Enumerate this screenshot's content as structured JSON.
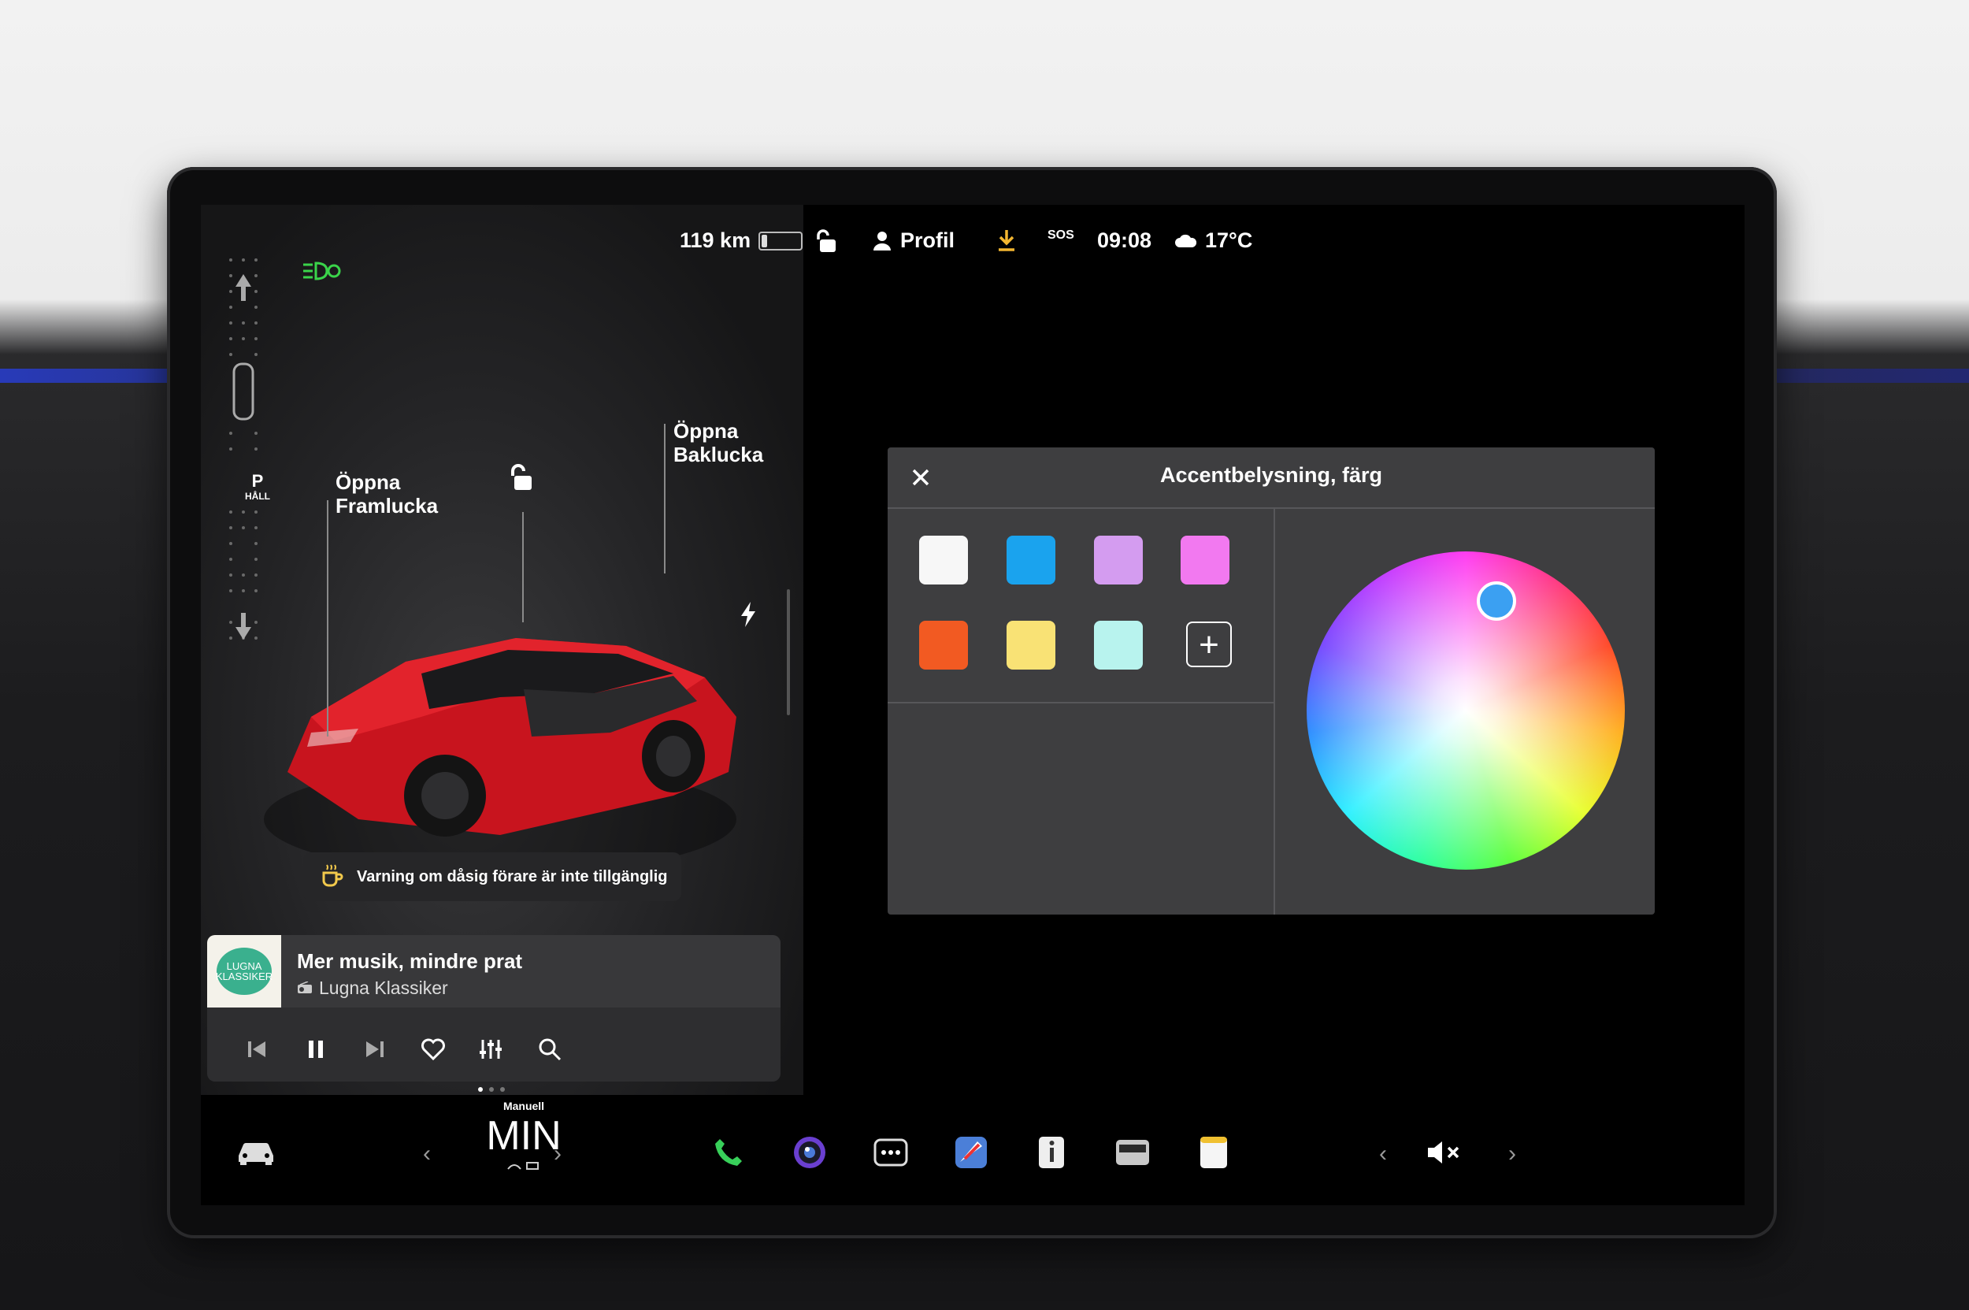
{
  "status_bar": {
    "range": "119 km",
    "battery_level_pct": 15,
    "profile_label": "Profil",
    "sos_label": "SOS",
    "time": "09:08",
    "temperature": "17°C",
    "icons": [
      "lock-open-icon",
      "person-icon",
      "download-icon",
      "sos-icon",
      "cloud-icon"
    ]
  },
  "car_panel": {
    "gear_selected": "P",
    "gear_hold": "HÅLL",
    "frunk_label": "Öppna\nFramlucka",
    "trunk_label": "Öppna\nBaklucka",
    "warning_text": "Varning om dåsig förare är inte tillgänglig",
    "icons": [
      "headlight-icon",
      "arrow-up-icon",
      "car-top-icon",
      "arrow-down-icon",
      "lock-open-icon",
      "charge-bolt-icon",
      "coffee-icon"
    ]
  },
  "music": {
    "title": "Mer musik, mindre prat",
    "source": "Lugna Klassiker",
    "cover_text": "LUGNA KLASSIKER",
    "controls": [
      "previous-icon",
      "pause-icon",
      "next-icon",
      "heart-icon",
      "equalizer-icon",
      "search-icon"
    ]
  },
  "dialog": {
    "title": "Accentbelysning, färg",
    "swatches": [
      "#f7f7f7",
      "#1aa3ee",
      "#d49cf0",
      "#f279f0",
      "#f25a22",
      "#f9e275",
      "#b8f3ee"
    ],
    "selected_color": "#3ba0f2",
    "add_label": "+"
  },
  "dock": {
    "climate_mode": "Manuell",
    "fan_value": "MIN",
    "apps": [
      "car-icon",
      "phone-icon",
      "camera-icon",
      "more-icon",
      "navigation-icon",
      "manual-icon",
      "dashcam-icon",
      "notes-icon"
    ],
    "volume_icon": "volume-mute-icon"
  },
  "colors": {
    "accent_blue": "#3ba0f2",
    "phone_green": "#38d05a",
    "headlight_green": "#3ad44a"
  }
}
